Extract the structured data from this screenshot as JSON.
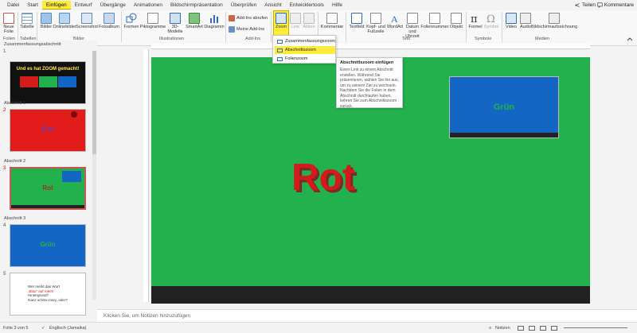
{
  "menu": {
    "items": [
      "Datei",
      "Start",
      "Einfügen",
      "Entwurf",
      "Übergänge",
      "Animationen",
      "Bildschirmpräsentation",
      "Überprüfen",
      "Ansicht",
      "Entwicklertools",
      "Hilfe"
    ],
    "active_index": 2,
    "share_label": "Teilen",
    "comments_label": "Kommentare"
  },
  "ribbon": {
    "new_slide": "Neue Folie",
    "table": "Tabelle",
    "images": "Bilder",
    "online_images": "Onlinebilder",
    "screenshot": "Screenshot",
    "photo_album": "Fotoalbum",
    "shapes": "Formen",
    "icons": "Piktogramme",
    "models_3d": "3D-Modelle",
    "smartart": "SmartArt",
    "chart": "Diagramm",
    "get_addins": "Add-Ins abrufen",
    "my_addins": "Meine Add-Ins",
    "zoom": "Zoom",
    "link": "Link",
    "action": "Aktion",
    "comment": "Kommentar",
    "textbox": "Textfeld",
    "header_footer": "Kopf- und Fußzeile",
    "wordart": "WordArt",
    "date_time": "Datum und Uhrzeit",
    "slide_number": "Foliennummer",
    "object": "Objekt",
    "equation": "Formel",
    "symbol": "Symbol",
    "video": "Video",
    "audio": "Audio",
    "screen_recording": "Bildschirmaufzeichnung",
    "groups": {
      "slides": "Folien",
      "tables": "Tabellen",
      "images": "Bilder",
      "illustrations": "Illustrationen",
      "addins": "Add-Ins",
      "text": "Text",
      "symbols": "Symbole",
      "media": "Medien"
    }
  },
  "zoom_menu": {
    "items": [
      "Zusammenfassungszoom",
      "Abschnittszoom",
      "Folienzoom"
    ],
    "highlighted_index": 1
  },
  "tooltip": {
    "title": "Abschnittszoom einfügen",
    "body": "Einen Link zu einem Abschnitt erstellen. Während Sie präsentieren, wählen Sie ihn aus, um zu seinem Ziel zu wechseln. Nachdem Sie die Folien in dem Abschnitt durchlaufen haben, kehren Sie zum Abschnittszoom zurück."
  },
  "slides_pane": {
    "sections": [
      "Zusammenfassungsabschnitt",
      "Abschnitt 1",
      "Abschnitt 2",
      "Abschnitt 3"
    ],
    "slide_numbers": [
      "1",
      "2",
      "3",
      "4",
      "5"
    ],
    "slide1_text": "Und es hat ZOOM gemacht!",
    "slide2_text": "Blau",
    "slide3_text": "Rot",
    "slide4_text": "Grün",
    "slide5_line1": "Wer merkt das Wort",
    "slide5_line2": "„Blau“ auf rotem",
    "slide5_line3": "Hintergrund?",
    "slide5_line4": "Ganz schön crazy, oder?"
  },
  "slide": {
    "main_text": "Rot",
    "box_text": "Grün"
  },
  "notes_placeholder": "Klicken Sie, um Notizen hinzuzufügen",
  "status": {
    "slide_info": "Folie 3 von 5",
    "language": "Englisch (Jamaika)",
    "notes": "Notizen"
  },
  "colors": {
    "slide_green": "#23b14d",
    "slide_red": "#d41b1b",
    "box_blue": "#1466c4",
    "highlight": "#ffeb3b"
  }
}
